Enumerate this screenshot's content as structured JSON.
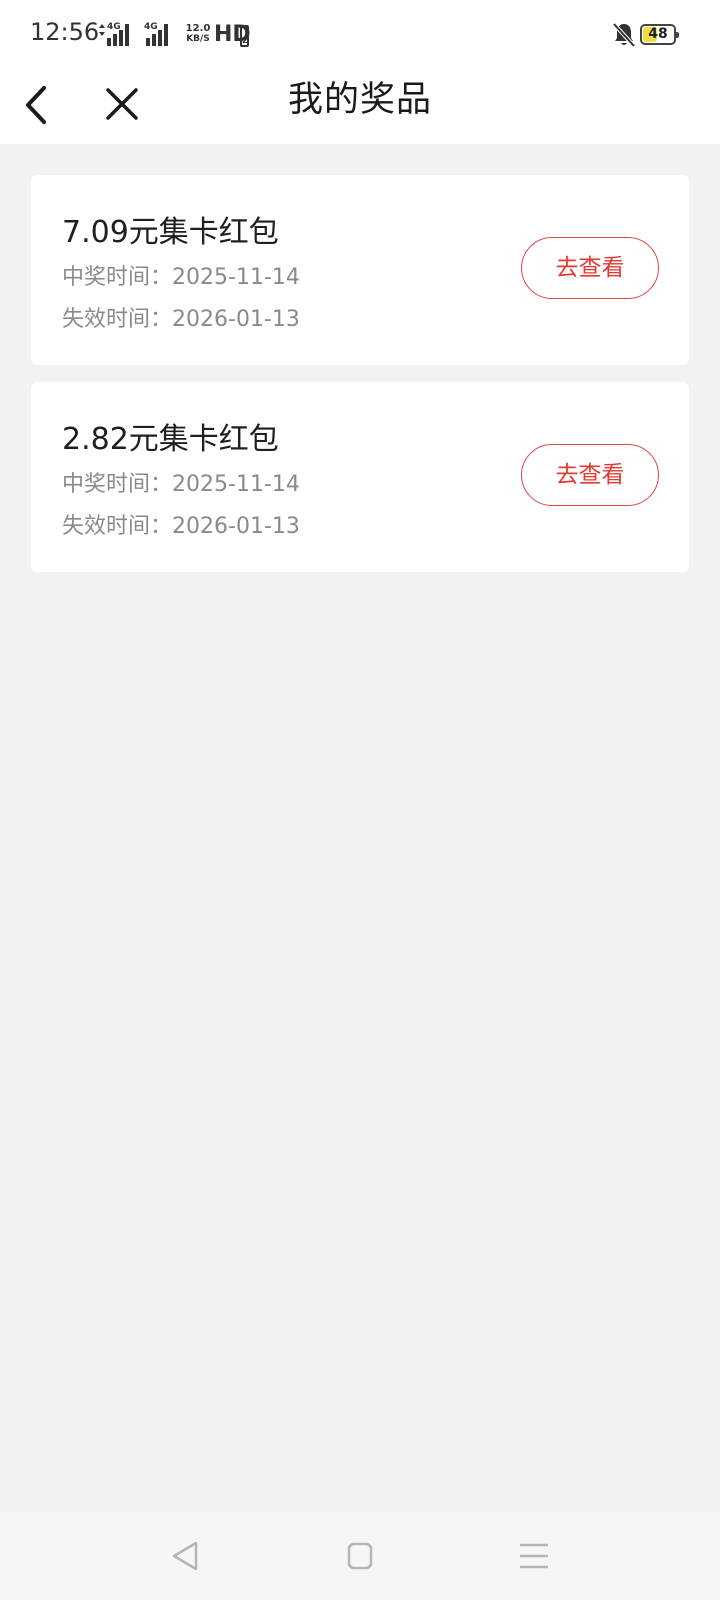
{
  "status_bar": {
    "time": "12:56",
    "network1": "4G",
    "network2": "4G",
    "speed_value": "12.0",
    "speed_unit": "KB/S",
    "hd": "HD",
    "hd_sim": "2",
    "battery": "48"
  },
  "header": {
    "title": "我的奖品"
  },
  "prizes": [
    {
      "title": "7.09元集卡红包",
      "win_label": "中奖时间：",
      "win_date": "2025-11-14",
      "expire_label": "失效时间：",
      "expire_date": "2026-01-13",
      "button": "去查看"
    },
    {
      "title": "2.82元集卡红包",
      "win_label": "中奖时间：",
      "win_date": "2025-11-14",
      "expire_label": "失效时间：",
      "expire_date": "2026-01-13",
      "button": "去查看"
    }
  ],
  "colors": {
    "accent": "#e23a32",
    "page_bg": "#f1f2f4",
    "card_bg": "#ffffff",
    "battery_fill": "#f5dc3c"
  },
  "icons": {
    "back": "chevron-left-icon",
    "close": "close-icon",
    "bell_muted": "bell-off-icon",
    "nav_back": "triangle-back-icon",
    "nav_home": "square-home-icon",
    "nav_menu": "menu-lines-icon"
  }
}
